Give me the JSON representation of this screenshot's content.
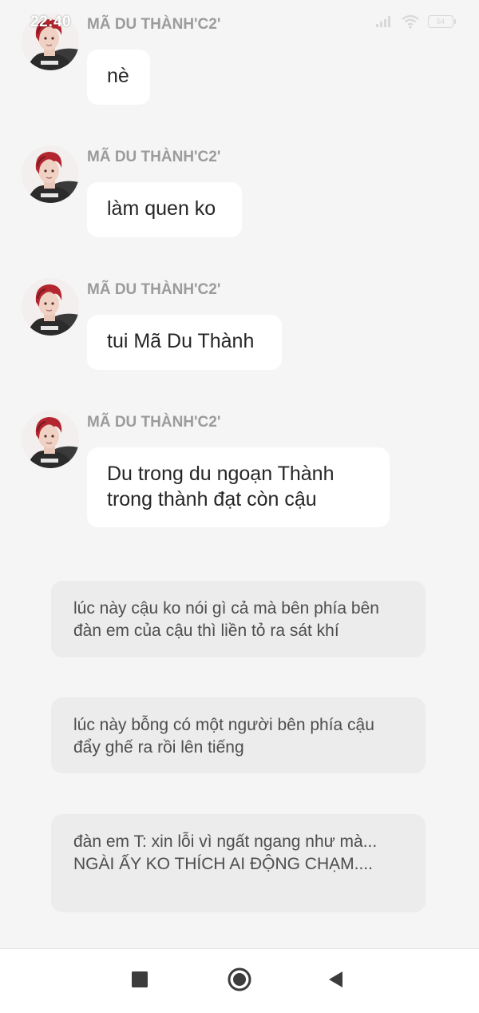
{
  "status_bar": {
    "time": "22:40",
    "battery_level": "54"
  },
  "messages": [
    {
      "sender": "MÃ DU THÀNH'C2'",
      "text": "nè"
    },
    {
      "sender": "MÃ DU THÀNH'C2'",
      "text": "làm quen ko"
    },
    {
      "sender": "MÃ DU THÀNH'C2'",
      "text": "tui Mã Du Thành"
    },
    {
      "sender": "MÃ DU THÀNH'C2'",
      "text": "Du trong du ngoạn Thành trong thành đạt còn cậu"
    }
  ],
  "narrations": [
    {
      "text": "lúc này cậu ko nói gì cả mà bên phía bên đàn em của cậu thì liền tỏ ra sát khí"
    },
    {
      "text": "lúc này bỗng có một người bên phía cậu đẩy ghế ra rồi lên tiếng"
    },
    {
      "text": "đàn em T: xin lỗi vì ngất ngang như mà... NGÀI ẤY KO THÍCH AI ĐỘNG CHẠM...."
    }
  ],
  "colors": {
    "background": "#f5f5f5",
    "bubble": "#ffffff",
    "narration": "#ececec",
    "sender": "#9b9b9b"
  },
  "icons": {
    "nav_recents": "square-icon",
    "nav_home": "circle-icon",
    "nav_back": "triangle-back-icon"
  }
}
